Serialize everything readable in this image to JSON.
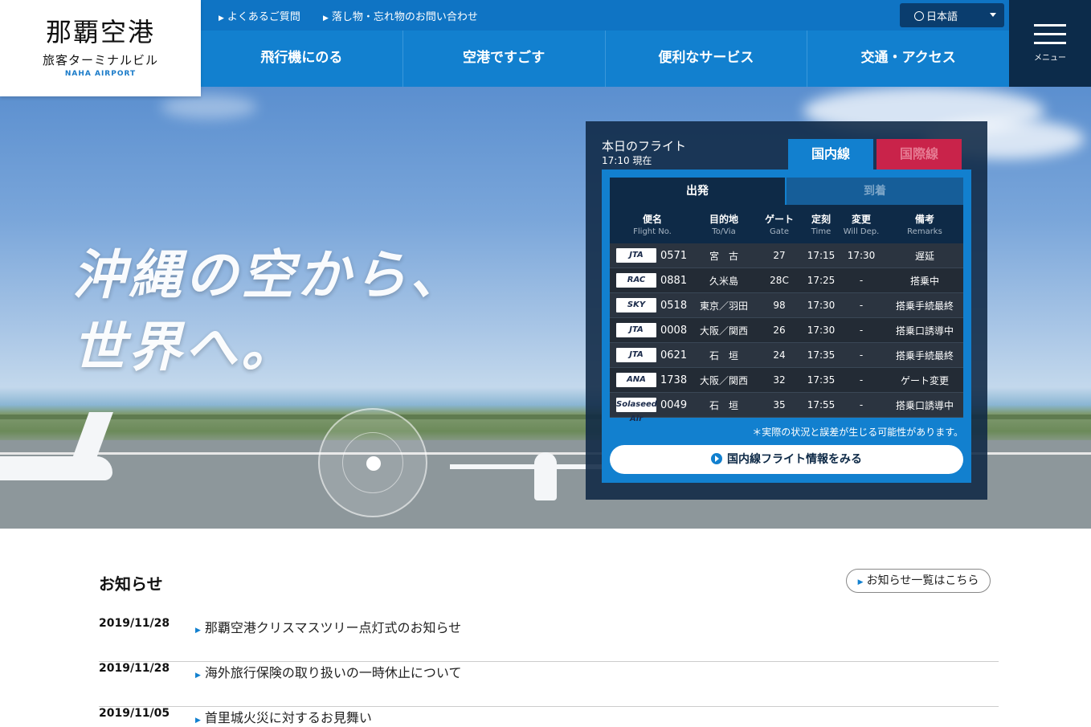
{
  "logo": {
    "main": "那覇空港",
    "sub": "旅客ターミナルビル",
    "en": "NAHA AIRPORT"
  },
  "topbar": {
    "links": [
      "よくあるご質問",
      "落し物・忘れ物のお問い合わせ"
    ],
    "language": "日本語"
  },
  "nav": {
    "items": [
      "飛行機にのる",
      "空港ですごす",
      "便利なサービス",
      "交通・アクセス"
    ],
    "menu_label": "メニュー"
  },
  "hero": {
    "line1": "沖縄の空から、",
    "line2": "世界へ。"
  },
  "flights": {
    "title": "本日のフライト",
    "time": "17:10 現在",
    "tab_domestic": "国内線",
    "tab_intl": "国際線",
    "tab_departure": "出発",
    "tab_arrival": "到着",
    "headers": [
      {
        "ja": "便名",
        "en": "Flight No."
      },
      {
        "ja": "目的地",
        "en": "To/Via"
      },
      {
        "ja": "ゲート",
        "en": "Gate"
      },
      {
        "ja": "定刻",
        "en": "Time"
      },
      {
        "ja": "変更",
        "en": "Will Dep."
      },
      {
        "ja": "備考",
        "en": "Remarks"
      }
    ],
    "rows": [
      {
        "airline": "JTA",
        "no": "0571",
        "dest": "宮　古",
        "gate": "27",
        "time": "17:15",
        "change": "17:30",
        "remarks": "遅延"
      },
      {
        "airline": "RAC",
        "no": "0881",
        "dest": "久米島",
        "gate": "28C",
        "time": "17:25",
        "change": "-",
        "remarks": "搭乗中"
      },
      {
        "airline": "SKY",
        "no": "0518",
        "dest": "東京／羽田",
        "gate": "98",
        "time": "17:30",
        "change": "-",
        "remarks": "搭乗手続最終"
      },
      {
        "airline": "JTA",
        "no": "0008",
        "dest": "大阪／関西",
        "gate": "26",
        "time": "17:30",
        "change": "-",
        "remarks": "搭乗口誘導中"
      },
      {
        "airline": "JTA",
        "no": "0621",
        "dest": "石　垣",
        "gate": "24",
        "time": "17:35",
        "change": "-",
        "remarks": "搭乗手続最終"
      },
      {
        "airline": "ANA",
        "no": "1738",
        "dest": "大阪／関西",
        "gate": "32",
        "time": "17:35",
        "change": "-",
        "remarks": "ゲート変更"
      },
      {
        "airline": "Solaseed Air",
        "no": "0049",
        "dest": "石　垣",
        "gate": "35",
        "time": "17:55",
        "change": "-",
        "remarks": "搭乗口誘導中"
      }
    ],
    "notice": "＊実際の状況と誤差が生じる可能性があります。",
    "more": "国内線フライト情報をみる"
  },
  "news": {
    "heading": "お知らせ",
    "all_link": "お知らせ一覧はこちら",
    "items": [
      {
        "date": "2019/11/28",
        "title": "那覇空港クリスマスツリー点灯式のお知らせ"
      },
      {
        "date": "2019/11/28",
        "title": "海外旅行保険の取り扱いの一時休止について"
      },
      {
        "date": "2019/11/05",
        "title": "首里城火災に対するお見舞い"
      }
    ]
  }
}
